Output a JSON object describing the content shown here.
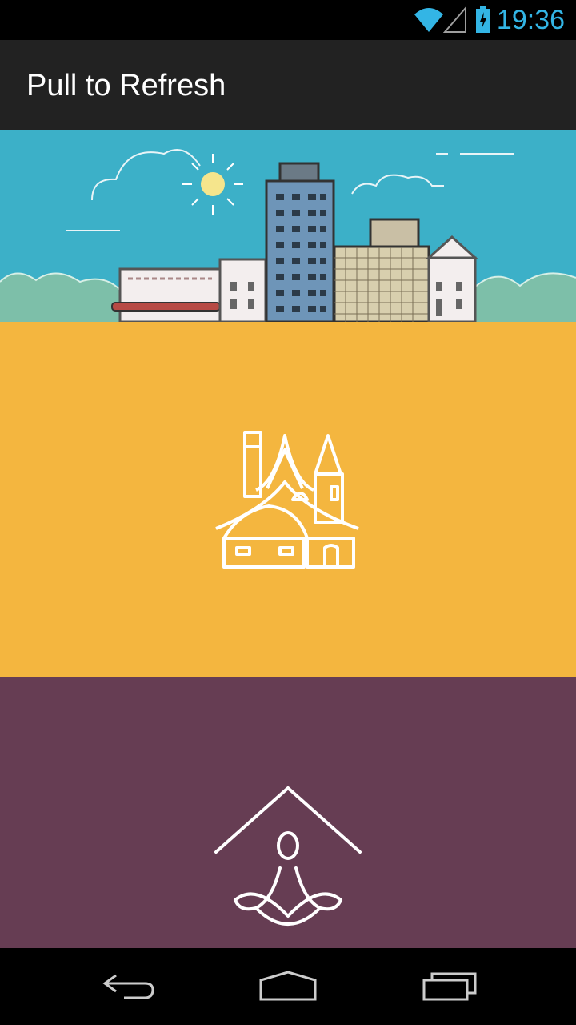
{
  "status_bar": {
    "time": "19:36",
    "icons": [
      "wifi-icon",
      "cell-signal-icon",
      "battery-charging-icon"
    ]
  },
  "action_bar": {
    "title": "Pull to Refresh"
  },
  "colors": {
    "status_accent": "#33b5e5",
    "action_bar_bg": "#222222",
    "header_sky": "#3cb0c8",
    "item_1_bg": "#f4b63f",
    "item_2_bg": "#663d53"
  },
  "list": {
    "items": [
      {
        "icon": "castle-icon",
        "bg": "#f4b63f"
      },
      {
        "icon": "meditation-house-icon",
        "bg": "#663d53"
      }
    ]
  },
  "nav_bar": {
    "buttons": [
      "back-icon",
      "home-icon",
      "recent-apps-icon"
    ]
  }
}
